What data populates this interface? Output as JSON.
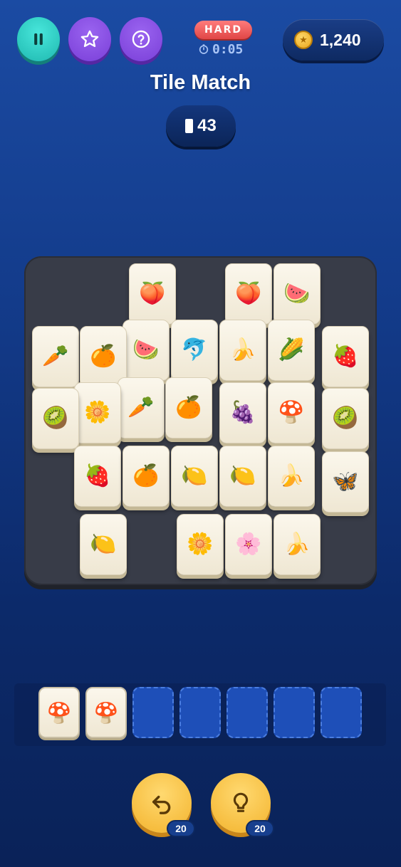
{
  "header": {
    "difficulty": "HARD",
    "timer": "0:05",
    "coins": "1,240",
    "title": "Tile Match",
    "tiles_remaining": "43",
    "icons": [
      "pause-icon",
      "star-icon",
      "help-icon",
      "clock-icon",
      "coin-icon"
    ]
  },
  "board": {
    "tiles": [
      {
        "emoji": "🍑",
        "name": "peach"
      },
      {
        "emoji": "🍑",
        "name": "peach"
      },
      {
        "emoji": "🍉",
        "name": "watermelon"
      },
      {
        "emoji": "🥕",
        "name": "carrot"
      },
      {
        "emoji": "🍊",
        "name": "orange"
      },
      {
        "emoji": "🍉",
        "name": "watermelon"
      },
      {
        "emoji": "🐬",
        "name": "dolphin"
      },
      {
        "emoji": "🍌",
        "name": "banana"
      },
      {
        "emoji": "🌽",
        "name": "corn"
      },
      {
        "emoji": "🍓",
        "name": "strawberry"
      },
      {
        "emoji": "🥝",
        "name": "kiwi"
      },
      {
        "emoji": "🌼",
        "name": "daisy"
      },
      {
        "emoji": "🥕",
        "name": "carrot"
      },
      {
        "emoji": "🍊",
        "name": "orange"
      },
      {
        "emoji": "🍇",
        "name": "grapes"
      },
      {
        "emoji": "🍄",
        "name": "mushroom"
      },
      {
        "emoji": "🥝",
        "name": "kiwi"
      },
      {
        "emoji": "🍓",
        "name": "strawberry"
      },
      {
        "emoji": "🍊",
        "name": "orange"
      },
      {
        "emoji": "🍋",
        "name": "lemon"
      },
      {
        "emoji": "🍋",
        "name": "lemon"
      },
      {
        "emoji": "🍌",
        "name": "banana"
      },
      {
        "emoji": "🦋",
        "name": "butterfly"
      },
      {
        "emoji": "🍋",
        "name": "lemon"
      },
      {
        "emoji": "🌼",
        "name": "daisy"
      },
      {
        "emoji": "🌸",
        "name": "blossom"
      },
      {
        "emoji": "🍌",
        "name": "banana"
      }
    ]
  },
  "tray": {
    "slots": [
      "🍄",
      "🍄",
      "",
      "",
      "",
      "",
      ""
    ]
  },
  "boosters": {
    "undo_count": "20",
    "hint_count": "20"
  },
  "colors": {
    "background_top": "#1b4ba3",
    "background_bottom": "#0a2258",
    "pause_button": "#2cc9bf",
    "star_button": "#8a4fe6",
    "difficulty_badge": "#f05a5a",
    "booster": "#f8c545",
    "board": "#383c48",
    "tile": "#f7f1e2",
    "empty_slot": "#1e4fb8"
  }
}
